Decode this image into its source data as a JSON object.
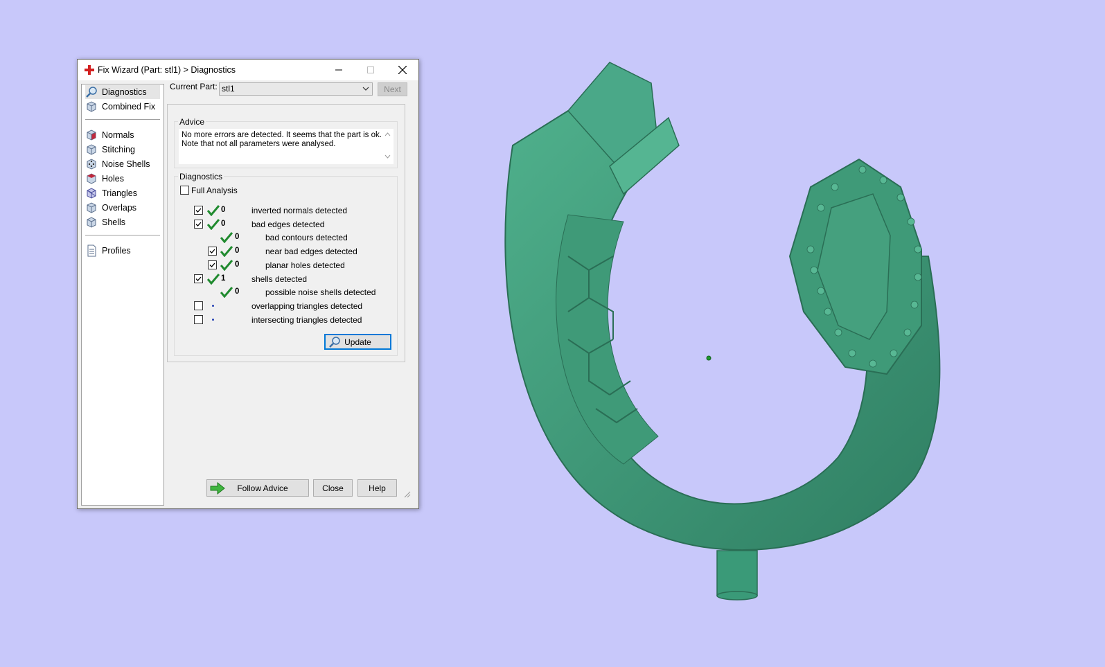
{
  "window": {
    "title": "Fix Wizard (Part: stl1) > Diagnostics"
  },
  "sidebar": {
    "items": [
      {
        "label": "Diagnostics",
        "icon": "magnifier-icon"
      },
      {
        "label": "Combined Fix",
        "icon": "cube-icon"
      },
      {
        "label": "Normals",
        "icon": "cube-red-icon"
      },
      {
        "label": "Stitching",
        "icon": "cube-icon"
      },
      {
        "label": "Noise Shells",
        "icon": "dice-icon"
      },
      {
        "label": "Holes",
        "icon": "cube-hole-icon"
      },
      {
        "label": "Triangles",
        "icon": "cube-icon"
      },
      {
        "label": "Overlaps",
        "icon": "cube-icon"
      },
      {
        "label": "Shells",
        "icon": "cube-icon"
      },
      {
        "label": "Profiles",
        "icon": "document-icon"
      }
    ]
  },
  "part": {
    "label": "Current Part:",
    "value": "stl1",
    "next_label": "Next"
  },
  "advice": {
    "title": "Advice",
    "text": "No more errors are detected. It seems that the part is ok.\nNote that not all parameters were analysed."
  },
  "diagnostics": {
    "title": "Diagnostics",
    "full_analysis_label": "Full Analysis",
    "rows": [
      {
        "count": "0",
        "label": "inverted normals detected"
      },
      {
        "count": "0",
        "label": "bad edges detected"
      },
      {
        "count": "0",
        "label": "bad contours detected"
      },
      {
        "count": "0",
        "label": "near bad edges detected"
      },
      {
        "count": "0",
        "label": "planar holes detected"
      },
      {
        "count": "1",
        "label": "shells detected"
      },
      {
        "count": "0",
        "label": "possible noise shells detected"
      },
      {
        "count": "",
        "label": "overlapping triangles detected"
      },
      {
        "count": "",
        "label": "intersecting triangles detected"
      }
    ],
    "update_label": "Update"
  },
  "footer": {
    "follow_advice_label": "Follow Advice",
    "close_label": "Close",
    "help_label": "Help"
  },
  "colors": {
    "background": "#c8c8fa",
    "model": "#3a9a78",
    "check_green": "#1f8a2e"
  }
}
